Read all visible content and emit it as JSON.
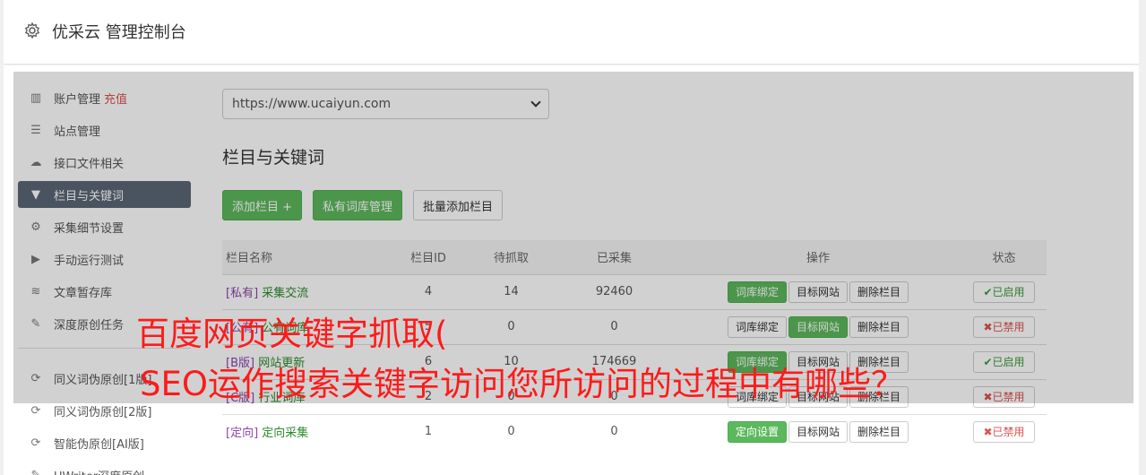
{
  "header": {
    "title": "优采云 管理控制台"
  },
  "sidebar": {
    "items": [
      {
        "label": "账户管理",
        "extra": "充值",
        "icon": "bar-chart-icon",
        "glyph": "▥"
      },
      {
        "label": "站点管理",
        "icon": "server-icon",
        "glyph": "☰"
      },
      {
        "label": "接口文件相关",
        "icon": "cloud-upload-icon",
        "glyph": "☁"
      },
      {
        "label": "栏目与关键词",
        "icon": "filter-icon",
        "glyph": "▼",
        "active": true
      },
      {
        "label": "采集细节设置",
        "icon": "cogs-icon",
        "glyph": "⚙"
      },
      {
        "label": "手动运行测试",
        "icon": "play-circle-icon",
        "glyph": "▶"
      },
      {
        "label": "文章暂存库",
        "icon": "database-icon",
        "glyph": "≋"
      },
      {
        "label": "深度原创任务",
        "icon": "edit-icon",
        "glyph": "✎"
      },
      {
        "label": "同义词伪原创[1版]",
        "icon": "refresh-icon",
        "glyph": "⟳"
      },
      {
        "label": "同义词伪原创[2版]",
        "icon": "refresh-icon",
        "glyph": "⟳"
      },
      {
        "label": "智能伪原创[AI版]",
        "icon": "refresh-icon",
        "glyph": "⟳"
      },
      {
        "label": "UWriter深度原创",
        "icon": "edit-icon",
        "glyph": "✎"
      }
    ]
  },
  "main": {
    "site_select": "https://www.ucaiyun.com",
    "section_title": "栏目与关键词",
    "buttons": {
      "add": "添加栏目 +",
      "private_lib": "私有词库管理",
      "batch_add": "批量添加栏目"
    },
    "table": {
      "headers": [
        "栏目名称",
        "栏目ID",
        "待抓取",
        "已采集",
        "操作",
        "状态"
      ],
      "rows": [
        {
          "tag": "[私有]",
          "name": "采集交流",
          "id": "4",
          "pending": "14",
          "collected": "92460",
          "op1": "词库绑定",
          "op1_green": true,
          "op2": "目标网站",
          "op2_green": false,
          "op3": "删除栏目",
          "status": "✔已启用",
          "on": true
        },
        {
          "tag": "[公有]",
          "name": "公有词库",
          "id": "5",
          "pending": "0",
          "collected": "0",
          "op1": "词库绑定",
          "op1_green": false,
          "op2": "目标网站",
          "op2_green": true,
          "op3": "删除栏目",
          "status": "✖已禁用",
          "on": false
        },
        {
          "tag": "[B版]",
          "name": "网站更新",
          "id": "6",
          "pending": "10",
          "collected": "174669",
          "op1": "词库绑定",
          "op1_green": true,
          "op2": "目标网站",
          "op2_green": false,
          "op3": "删除栏目",
          "status": "✔已启用",
          "on": true
        },
        {
          "tag": "[C版]",
          "name": "行业词库",
          "id": "2",
          "pending": "0",
          "collected": "0",
          "op1": "词库绑定",
          "op1_green": false,
          "op2": "目标网站",
          "op2_green": false,
          "op3": "删除栏目",
          "status": "✖已禁用",
          "on": false
        },
        {
          "tag": "[定向]",
          "name": "定向采集",
          "id": "1",
          "pending": "0",
          "collected": "0",
          "op1": "定向设置",
          "op1_green": true,
          "op2": "目标网站",
          "op2_green": false,
          "op3": "删除栏目",
          "status": "✖已禁用",
          "on": false
        }
      ]
    }
  },
  "overlay_caption": {
    "line1": "百度网页关键字抓取(",
    "line2": "SEO运作搜索关键字访问您所访问的过程中有哪些？"
  }
}
